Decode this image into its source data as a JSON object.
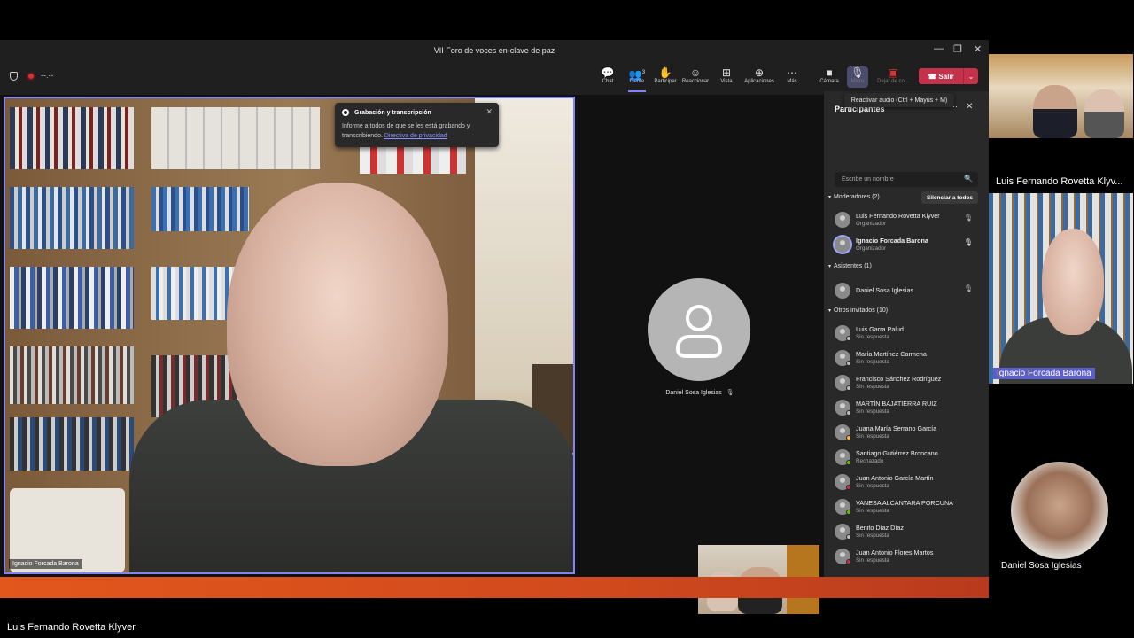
{
  "window": {
    "title": "VII Foro de voces en-clave de paz",
    "minimize": "—",
    "restore": "❐",
    "close": "✕"
  },
  "recording": {
    "time": "--:--"
  },
  "toolbar": {
    "chat": "Chat",
    "people": "Gente",
    "people_count": "3",
    "raise": "Participar",
    "react": "Reaccionar",
    "view": "Vista",
    "apps": "Aplicaciones",
    "more": "Más",
    "camera": "Cámara",
    "mic": "Micro",
    "share": "Dejar de co...",
    "leave": "Salir",
    "mic_tooltip": "Reactivar audio (Ctrl + Mayús + M)"
  },
  "toast": {
    "title": "Grabación y transcripción",
    "body": "Informe a todos de que se les está grabando y transcribiendo.",
    "link": "Directiva de privacidad"
  },
  "stage": {
    "main_speaker": "Ignacio Forcada Barona",
    "tile_name": "Daniel Sosa Iglesias"
  },
  "panel": {
    "title": "Participantes",
    "search_placeholder": "Escribe un nombre",
    "mute_all": "Silenciar a todos",
    "sections": {
      "moderators": "Moderadores (2)",
      "attendees": "Asistentes (1)",
      "others": "Otros invitados (10)"
    },
    "moderators": [
      {
        "name": "Luis Fernando Rovetta Klyver",
        "status": "Organizador"
      },
      {
        "name": "Ignacio Forcada Barona",
        "status": "Organizador"
      }
    ],
    "attendees": [
      {
        "name": "Daniel Sosa Iglesias",
        "status": ""
      }
    ],
    "others": [
      {
        "name": "Luis Garra Palud",
        "status": "Sin respuesta"
      },
      {
        "name": "María Martínez Carmena",
        "status": "Sin respuesta"
      },
      {
        "name": "Francisco Sánchez Rodríguez",
        "status": "Sin respuesta"
      },
      {
        "name": "MARTÍN BAJATIERRA RUIZ",
        "status": "Sin respuesta"
      },
      {
        "name": "Juana María Serrano García",
        "status": "Sin respuesta"
      },
      {
        "name": "Santiago Gutiérrez Broncano",
        "status": "Rechazado"
      },
      {
        "name": "Juan Antonio García Martín",
        "status": "Sin respuesta"
      },
      {
        "name": "VANESA ALCÁNTARA PORCUNA",
        "status": "Sin respuesta"
      },
      {
        "name": "Benito Díaz Díaz",
        "status": "Sin respuesta"
      },
      {
        "name": "Juan Antonio Flores Martos",
        "status": "Sin respuesta"
      }
    ]
  },
  "broadcast": {
    "bottom_name": "Luis Fernando Rovetta Klyver",
    "top_right_name": "Luis Fernando Rovetta Klyv...",
    "mid_right_name": "Ignacio Forcada Barona",
    "bottom_right_name": "Daniel Sosa Iglesias"
  },
  "colors": {
    "accent": "#7f85f5",
    "leave": "#c4314b",
    "banner": "#e2571c"
  }
}
